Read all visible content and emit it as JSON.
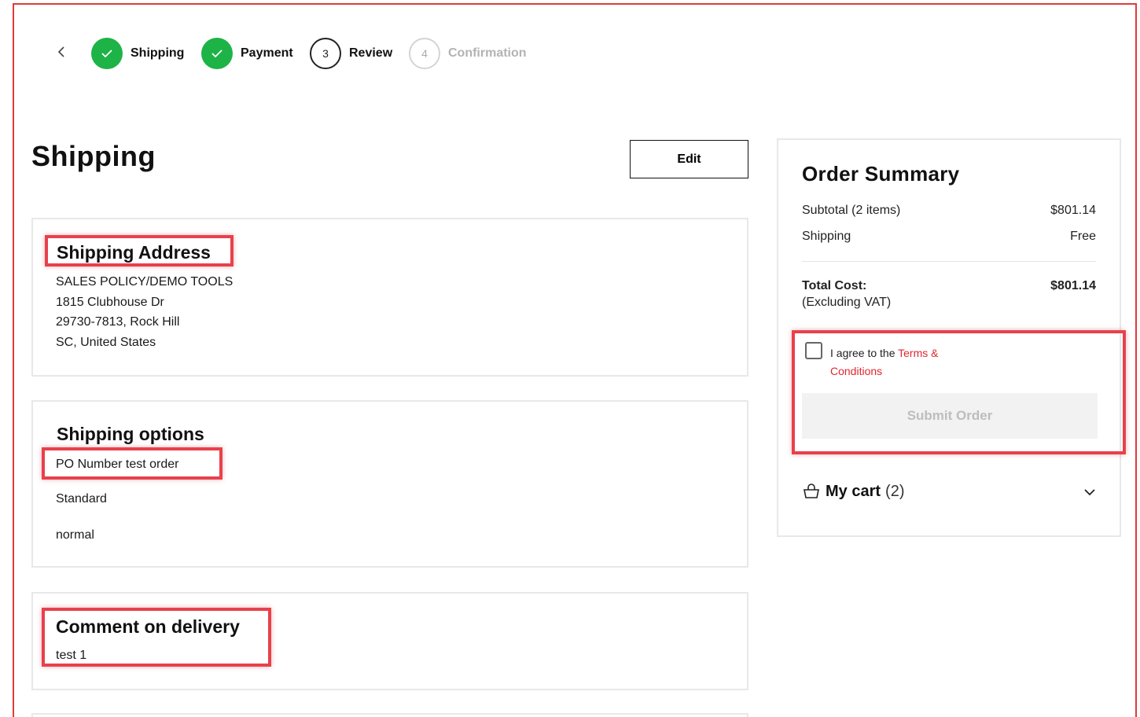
{
  "stepper": {
    "steps": [
      {
        "label": "Shipping",
        "state": "done"
      },
      {
        "label": "Payment",
        "state": "done"
      },
      {
        "label": "Review",
        "number": "3",
        "state": "active"
      },
      {
        "label": "Confirmation",
        "number": "4",
        "state": "todo"
      }
    ]
  },
  "page": {
    "title": "Shipping",
    "edit_label": "Edit"
  },
  "shipping_address": {
    "heading": "Shipping Address",
    "lines": [
      "SALES POLICY/DEMO TOOLS",
      "1815 Clubhouse Dr",
      "29730-7813, Rock Hill",
      "SC, United States"
    ]
  },
  "shipping_options": {
    "heading": "Shipping options",
    "po_number": "PO Number test order",
    "method": "Standard",
    "priority": "normal"
  },
  "comment": {
    "heading": "Comment on delivery",
    "text": "test 1"
  },
  "summary": {
    "title": "Order Summary",
    "subtotal_label": "Subtotal (2 items)",
    "subtotal_value": "$801.14",
    "shipping_label": "Shipping",
    "shipping_value": "Free",
    "total_label": "Total Cost:",
    "total_note": "(Excluding VAT)",
    "total_value": "$801.14",
    "agree_prefix": "I agree to the ",
    "terms_link": "Terms & Conditions",
    "submit_label": "Submit Order",
    "cart_label": "My cart",
    "cart_count": "(2)"
  },
  "colors": {
    "success": "#1db347",
    "accent_red": "#e0262f",
    "highlight": "#e8414b"
  }
}
